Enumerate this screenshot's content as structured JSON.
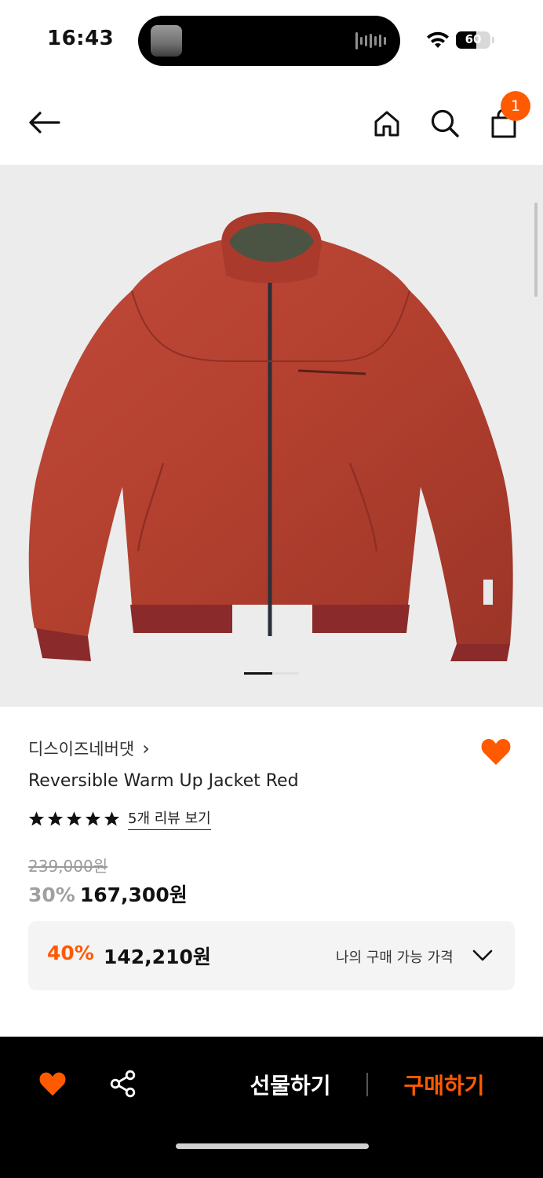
{
  "status_bar": {
    "time": "16:43",
    "battery": "60",
    "battery_level": 0.6,
    "icons": [
      "island-thumbnail",
      "audio-waveform-icon",
      "wifi-icon",
      "battery-icon"
    ]
  },
  "nav": {
    "icons": [
      "back-arrow-icon",
      "home-icon",
      "search-icon",
      "shopping-bag-icon"
    ],
    "cart_count": "1"
  },
  "product_image": {
    "subject": "red reversible jacket",
    "image_count_indicator": "page-1-active"
  },
  "product": {
    "brand": "디스이즈네버댓",
    "brand_chevron": "›",
    "name": "Reversible Warm Up Jacket Red",
    "rating_stars": 5,
    "review_link": "5개 리뷰 보기",
    "original_price": "239,000원",
    "discount_rate": "30%",
    "sale_price": "167,300원"
  },
  "my_price": {
    "discount_rate": "40%",
    "price": "142,210원",
    "label": "나의 구매 가능 가격"
  },
  "bottom_bar": {
    "gift_label": "선물하기",
    "buy_label": "구매하기",
    "icons": [
      "heart-icon",
      "share-icon"
    ]
  },
  "colors": {
    "accent": "#ff5a00",
    "bottom_bar_bg": "#000000",
    "image_bg": "#ececec",
    "price_box_bg": "#f4f4f4"
  }
}
